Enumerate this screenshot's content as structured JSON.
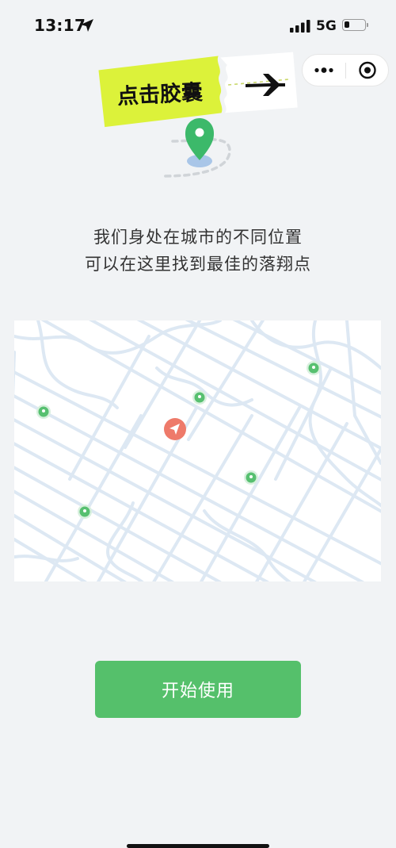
{
  "status_bar": {
    "time": "13:17",
    "network": "5G",
    "battery_level": 0.2
  },
  "capsule": {
    "more_icon": "ellipsis-icon",
    "close_icon": "target-circle-icon"
  },
  "header": {
    "logo_text": "点击胶囊",
    "logo_icon": "airplane-icon",
    "pin_color": "#3cb96a"
  },
  "intro": {
    "line1": "我们身处在城市的不同位置",
    "line2": "可以在这里找到最佳的落翔点"
  },
  "map": {
    "road_color": "#dde8f3",
    "pin_color": "#57c070",
    "user_marker_color": "#ee7a6a"
  },
  "start_button": {
    "label": "开始使用",
    "color": "#55c06b"
  }
}
